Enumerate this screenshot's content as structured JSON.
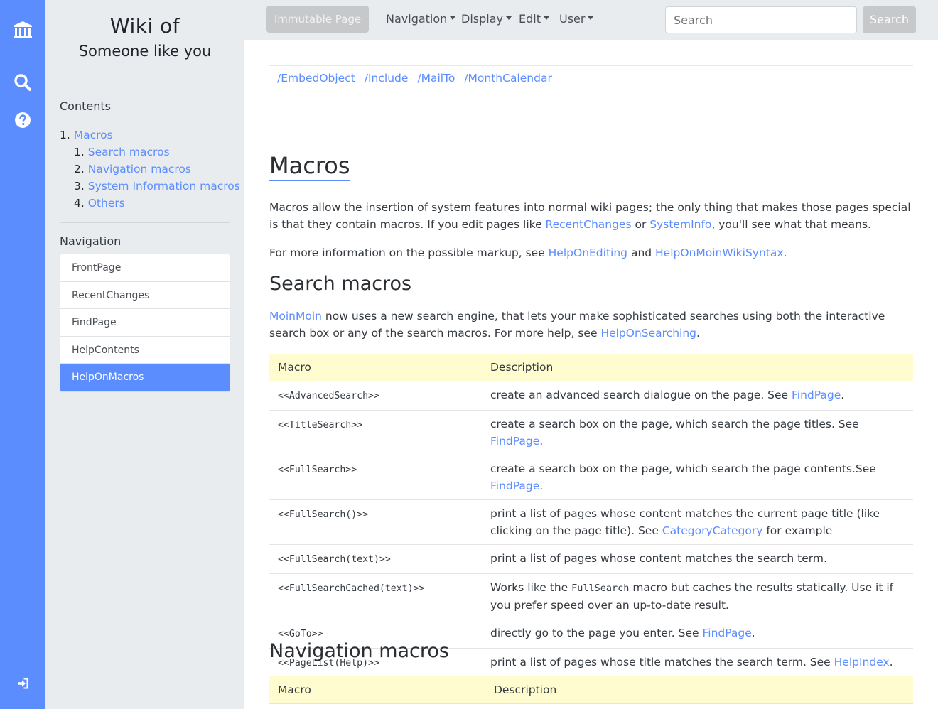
{
  "colors": {
    "accent": "#5c8dff",
    "sidebar_bg": "#e9ecef",
    "table_header_bg": "#fffdd0"
  },
  "rail": {
    "icons": [
      "bank-icon",
      "search-icon",
      "help-icon",
      "login-icon"
    ]
  },
  "sidebar": {
    "title_line1": "Wiki of",
    "title_line2": "Someone like you",
    "contents_heading": "Contents",
    "toc": [
      {
        "num": "1.",
        "label": "Macros"
      },
      {
        "num": "1.",
        "label": "Search macros"
      },
      {
        "num": "2.",
        "label": "Navigation macros"
      },
      {
        "num": "3.",
        "label": "System Information macros"
      },
      {
        "num": "4.",
        "label": "Others"
      }
    ],
    "navigation_heading": "Navigation",
    "nav_items": [
      "FrontPage",
      "RecentChanges",
      "FindPage",
      "HelpContents",
      "HelpOnMacros"
    ],
    "nav_active": "HelpOnMacros"
  },
  "topbar": {
    "immutable_label": "Immutable Page",
    "menus": [
      "Navigation",
      "Display",
      "Edit",
      "User"
    ],
    "search_placeholder": "Search",
    "search_button": "Search"
  },
  "main": {
    "sublinks": [
      "/EmbedObject",
      "/Include",
      "/MailTo",
      "/MonthCalendar"
    ],
    "h1": "Macros",
    "intro_a": "Macros allow the insertion of system features into normal wiki pages; the only thing that makes those pages special is that they contain macros. If you edit pages like ",
    "intro_link1": "RecentChanges",
    "intro_b": " or ",
    "intro_link2": "SystemInfo",
    "intro_c": ", you'll see what that means.",
    "more_a": "For more information on the possible markup, see ",
    "more_link1": "HelpOnEditing",
    "more_b": " and ",
    "more_link2": "HelpOnMoinWikiSyntax",
    "more_c": ".",
    "h2_search": "Search macros",
    "search_intro_link": "MoinMoin",
    "search_intro_a": " now uses a new search engine, that lets your make sophisticated searches using both the interactive search box or any of the search macros. For more help, see ",
    "search_intro_link2": "HelpOnSearching",
    "search_intro_b": ".",
    "table_header": {
      "macro": "Macro",
      "description": "Description"
    },
    "search_rows": [
      {
        "macro": "<<AdvancedSearch>>",
        "desc_a": "create an advanced search dialogue on the page. See ",
        "link": "FindPage",
        "desc_b": "."
      },
      {
        "macro": "<<TitleSearch>>",
        "desc_a": "create a search box on the page, which search the page titles. See ",
        "link": "FindPage",
        "desc_b": "."
      },
      {
        "macro": "<<FullSearch>>",
        "desc_a": "create a search box on the page, which search the page contents.See ",
        "link": "FindPage",
        "desc_b": "."
      },
      {
        "macro": "<<FullSearch()>>",
        "desc_a": "print a list of pages whose content matches the current page title (like clicking on the page title). See ",
        "link": "CategoryCategory",
        "desc_b": " for example"
      },
      {
        "macro": "<<FullSearch(text)>>",
        "desc_a": "print a list of pages whose content matches the search term.",
        "link": "",
        "desc_b": ""
      },
      {
        "macro": "<<FullSearchCached(text)>>",
        "desc_a": "Works like the ",
        "code": "FullSearch",
        "desc_c": " macro but caches the results statically. Use it if you prefer speed over an up-to-date result."
      },
      {
        "macro": "<<GoTo>>",
        "desc_a": "directly go to the page you enter. See ",
        "link": "FindPage",
        "desc_b": "."
      },
      {
        "macro": "<<PageList(Help)>>",
        "desc_a": "print a list of pages whose title matches the search term. See ",
        "link": "HelpIndex",
        "desc_b": "."
      }
    ],
    "h2_nav": "Navigation macros"
  }
}
